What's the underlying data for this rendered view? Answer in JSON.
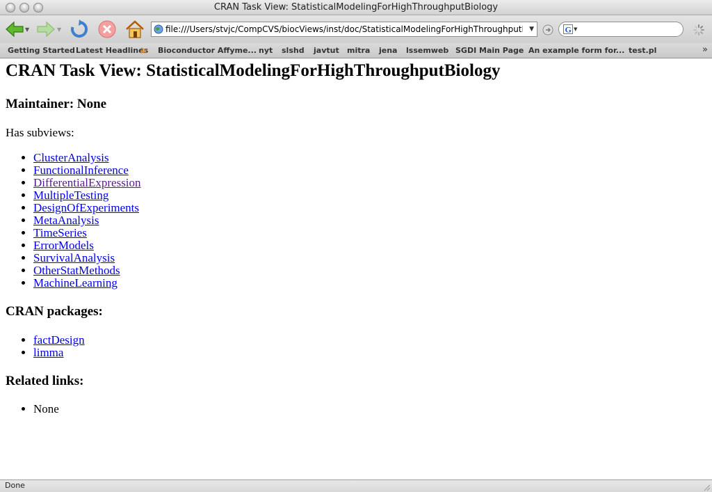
{
  "window": {
    "title": "CRAN Task View: StatisticalModelingForHighThroughputBiology"
  },
  "toolbar": {
    "url": "file:///Users/stvjc/CompCVS/biocViews/inst/doc/StatisticalModelingForHighThroughputB",
    "search_placeholder": ""
  },
  "bookmarks": [
    {
      "label": "Getting Started"
    },
    {
      "label": "Latest Headlines"
    },
    {
      "label": "Bioconductor Affyme..."
    },
    {
      "label": "nyt"
    },
    {
      "label": "slshd"
    },
    {
      "label": "javtut"
    },
    {
      "label": "mitra"
    },
    {
      "label": "jena"
    },
    {
      "label": "lssemweb"
    },
    {
      "label": "SGDI Main Page"
    },
    {
      "label": "An example form for..."
    },
    {
      "label": "test.pl"
    }
  ],
  "page": {
    "heading": "CRAN Task View: StatisticalModelingForHighThroughputBiology",
    "maintainer": "Maintainer: None",
    "subviews_label": "Has subviews:",
    "subviews": [
      "ClusterAnalysis",
      "FunctionalInference",
      "DifferentialExpression",
      "MultipleTesting",
      "DesignOfExperiments",
      "MetaAnalysis",
      "TimeSeries",
      "ErrorModels",
      "SurvivalAnalysis",
      "OtherStatMethods",
      "MachineLearning"
    ],
    "packages_heading": "CRAN packages:",
    "packages": [
      "factDesign",
      "limma"
    ],
    "related_heading": "Related links:",
    "related": [
      "None"
    ]
  },
  "status": {
    "text": "Done"
  },
  "colors": {
    "link": "#0000ee",
    "visited_link": "#551a8b"
  }
}
